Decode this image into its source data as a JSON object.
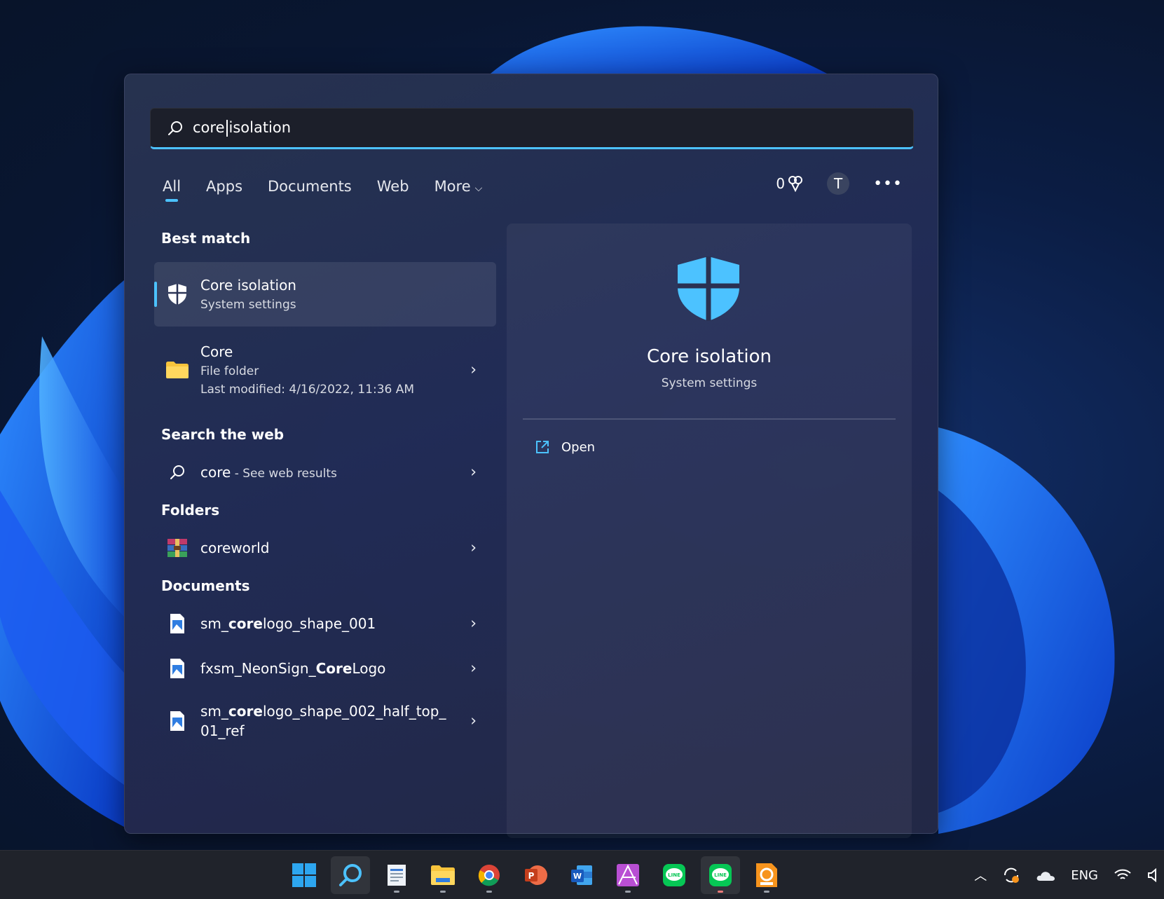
{
  "search": {
    "query_before_caret": "core",
    "query_after_caret": "isolation"
  },
  "tabs": [
    {
      "label": "All",
      "active": true
    },
    {
      "label": "Apps"
    },
    {
      "label": "Documents"
    },
    {
      "label": "Web"
    },
    {
      "label": "More"
    }
  ],
  "header_right": {
    "rewards_points": "0",
    "avatar_initial": "T"
  },
  "sections": {
    "best_match": "Best match",
    "search_web": "Search the web",
    "folders": "Folders",
    "documents": "Documents"
  },
  "best_match": {
    "title": "Core isolation",
    "subtitle": "System settings"
  },
  "core_folder": {
    "title": "Core",
    "type": "File folder",
    "modified": "Last modified: 4/16/2022, 11:36 AM"
  },
  "web": {
    "query": "core",
    "suffix": " - See web results"
  },
  "folders": [
    {
      "name": "coreworld"
    }
  ],
  "documents": [
    {
      "pre": "sm_",
      "bold": "core",
      "post": "logo_shape_001"
    },
    {
      "pre": "fxsm_NeonSign_",
      "bold": "Core",
      "post": "Logo"
    },
    {
      "pre": "sm_",
      "bold": "core",
      "post": "logo_shape_002_half_top_",
      "line2": "01_ref"
    }
  ],
  "detail": {
    "title": "Core isolation",
    "subtitle": "System settings",
    "action_open": "Open"
  },
  "tray": {
    "language": "ENG"
  },
  "colors": {
    "accent": "#4cc2ff",
    "shield": "#4cc2ff",
    "folder": "#f8c43c"
  }
}
